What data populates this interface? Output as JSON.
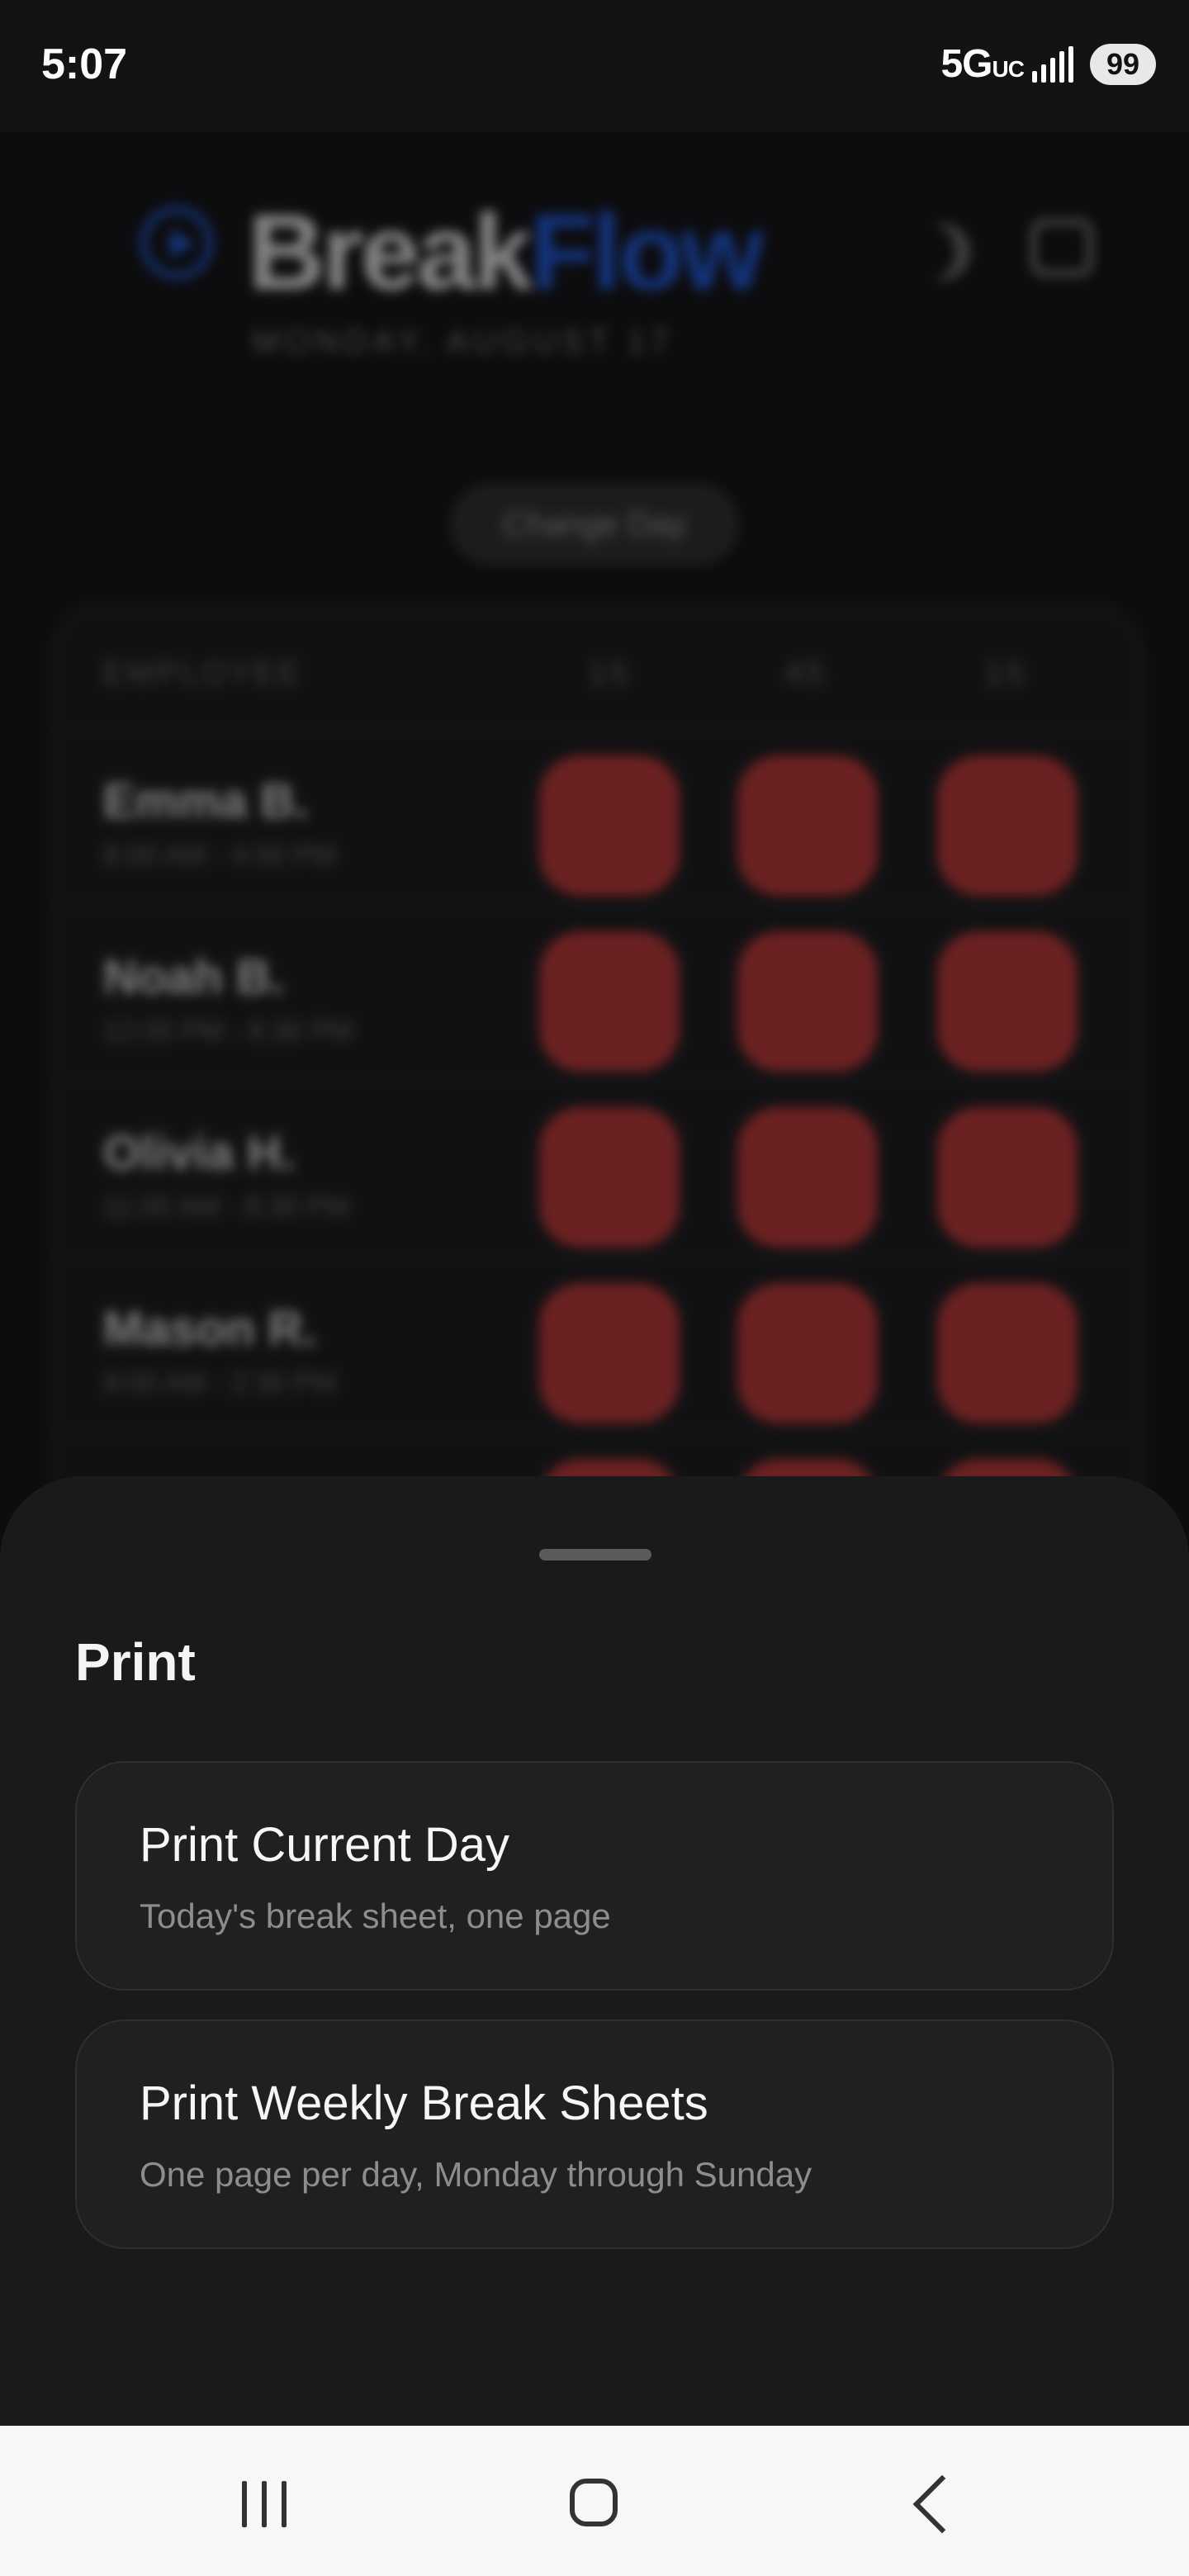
{
  "status_bar": {
    "time": "5:07",
    "network": "5G",
    "network_suffix": "UC",
    "battery": "99"
  },
  "background_app": {
    "brand_part1": "Break",
    "brand_part2": "Flow",
    "brand_accent_color": "#1a55d6",
    "date": "MONDAY, AUGUST 17",
    "change_day_label": "Change Day",
    "table_headers": [
      "EMPLOYEE",
      "15",
      "45",
      "15"
    ],
    "rows": [
      {
        "name": "Emma B.",
        "hours": "8:00 AM - 4:00 PM"
      },
      {
        "name": "Noah B.",
        "hours": "12:00 PM - 8:30 PM"
      },
      {
        "name": "Olivia H.",
        "hours": "11:00 AM - 8:30 PM"
      },
      {
        "name": "Mason R.",
        "hours": "9:00 AM - 2:30 PM"
      }
    ],
    "break_cell_color": "#b83232"
  },
  "sheet": {
    "title": "Print",
    "options": [
      {
        "title": "Print Current Day",
        "subtitle": "Today's break sheet, one page"
      },
      {
        "title": "Print Weekly Break Sheets",
        "subtitle": "One page per day, Monday through Sunday"
      }
    ]
  },
  "nav": {
    "icons": [
      "recents-icon",
      "home-icon",
      "back-icon"
    ]
  }
}
